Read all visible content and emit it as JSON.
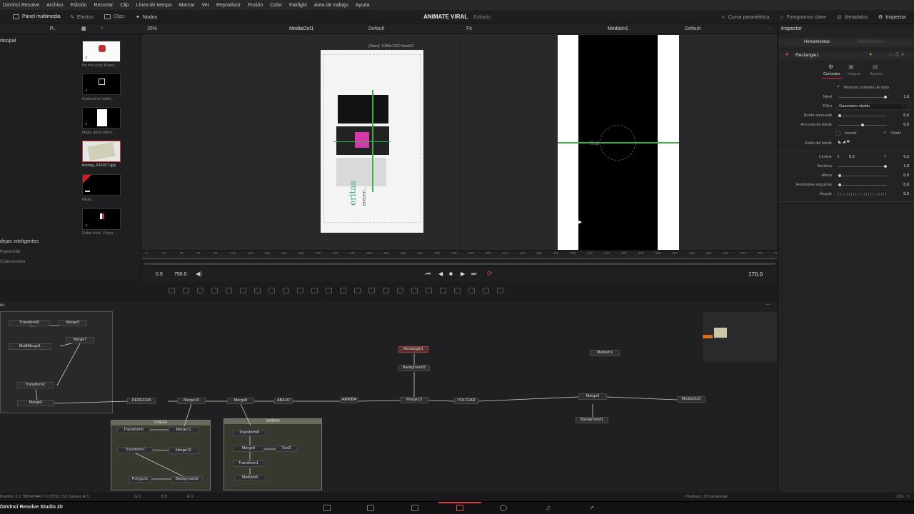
{
  "menu": [
    "DaVinci Resolve",
    "Archivo",
    "Edición",
    "Recortar",
    "Clip",
    "Línea de tiempo",
    "Marcar",
    "Ver",
    "Reproducir",
    "Fusión",
    "Color",
    "Fairlight",
    "Área de trabajo",
    "Ayuda"
  ],
  "toolbar": {
    "panel_multimedia": "Panel multimedia",
    "efectos": "Efectos",
    "clips": "Clips",
    "nodos": "Nodos",
    "project_title": "ANIMATE VIRAL",
    "project_status": "Editado",
    "curva": "Curva paramétrica",
    "fotogramas": "Fotogramas clave",
    "metadatos": "Metadatos",
    "inspector": "Inspector"
  },
  "viewer_bar": {
    "zoom_left": "25%",
    "name_left": "MediaOut1",
    "default_left": "Default",
    "fit": "Fit",
    "name_right": "MediaIn1",
    "default_right": "Default",
    "inspector_title": "Inspector"
  },
  "media_pool": {
    "bin_name": "rincipal",
    "smart_bins": "dejas inteligentes",
    "keywords": "Keywords",
    "collections": "Colecciones",
    "clips": [
      {
        "caption": "Be the cook.Brand..."
      },
      {
        "caption": "Cooked or hatlet..."
      },
      {
        "caption": "Make good offers ..."
      },
      {
        "caption": "money_514927.jpg"
      },
      {
        "caption": "REEL"
      },
      {
        "caption": "Sales trick...If you ..."
      }
    ]
  },
  "viewer_left": {
    "overlay": "[Main]: 1080x1920 float32",
    "brand_text": "eritas",
    "brand_sub": "erecen..."
  },
  "viewer_right": {
    "word": "that"
  },
  "ruler_ticks": [
    "0",
    "20",
    "40",
    "60",
    "80",
    "100",
    "120",
    "140",
    "160",
    "180",
    "200",
    "220",
    "240",
    "260",
    "280",
    "300",
    "320",
    "340",
    "360",
    "380",
    "400",
    "420",
    "440",
    "460",
    "480",
    "500",
    "520",
    "540",
    "560",
    "580",
    "600",
    "620",
    "640",
    "660",
    "680",
    "700",
    "720",
    "740"
  ],
  "transport": {
    "start": "0.0",
    "end": "750.0",
    "current": "170.0"
  },
  "nodes": {
    "transform5": "Transform5",
    "merge5": "Merge5",
    "multimerge1": "MultiMerge1",
    "merge7": "Merge7",
    "transform2": "Transform2",
    "merge6": "Merge6",
    "derecha": "DERECHA",
    "merge10": "Merge10",
    "merge8": "Merge8",
    "abajo": "ABAJO",
    "arriba": "ARRIBA",
    "merge13": "Merge13",
    "volteAR": "VOLTEAR",
    "merge3": "Merge3",
    "mediaout1": "MediaOut1",
    "rectangle1": "Rectangle1",
    "background3": "Background3",
    "mediain1": "MediaIn1",
    "background1": "Background1",
    "group_lineas": "LINEAS",
    "transform6": "Transform6",
    "merge11": "Merge11",
    "transform7": "Transform7",
    "merge12": "Merge12",
    "polygon1": "Polygon1",
    "background2": "Background2",
    "group_dinero": "DINERO",
    "transform8": "Transform8",
    "merge9": "Merge9",
    "text2": "Text2",
    "transform1": "Transform1",
    "mediain5": "MediaIn5"
  },
  "inspector": {
    "tab_tools": "Herramientas",
    "tab_mods": "Modificadores",
    "node_name": "Rectangle1",
    "sub_controles": "Controles",
    "sub_imagen": "Imagen",
    "sub_ajustes": "Ajustes",
    "show_controls": "Mostrar controles de vista",
    "nivel_label": "Nivel",
    "nivel_val": "1.0",
    "filtro_label": "Filtro",
    "filtro_val": "Gaussiano rápido",
    "borde_atenuado_label": "Borde atenuado",
    "borde_atenuado_val": "0.0",
    "anchura_borde_label": "Anchura de borde",
    "anchura_borde_val": "0.0",
    "invertir": "Invertir",
    "solido": "Sólido",
    "estilo_borde_label": "Estilo del borde",
    "centrar_label": "Centrar",
    "centrar_x_lbl": "X",
    "centrar_x": "0.5",
    "centrar_y_lbl": "Y",
    "centrar_y": "0.5",
    "anchura_label": "Anchura",
    "anchura_val": "1.0",
    "altura_label": "Altura",
    "altura_val": "0.0",
    "redondear_label": "Redondear esquinas",
    "redondear_val": "0.0",
    "angulo_label": "Ángulo",
    "angulo_val": "0.0"
  },
  "status": {
    "position": "Position  X 1.78834   644   Y 0.23793   152   Canvas R 0",
    "g": "G 0",
    "b": "B 0",
    "a": "A 0",
    "playback": "Playback: 23 frames/sec",
    "mem": "11% · 3"
  },
  "app_name": "DaVinci Resolve Studio 20"
}
